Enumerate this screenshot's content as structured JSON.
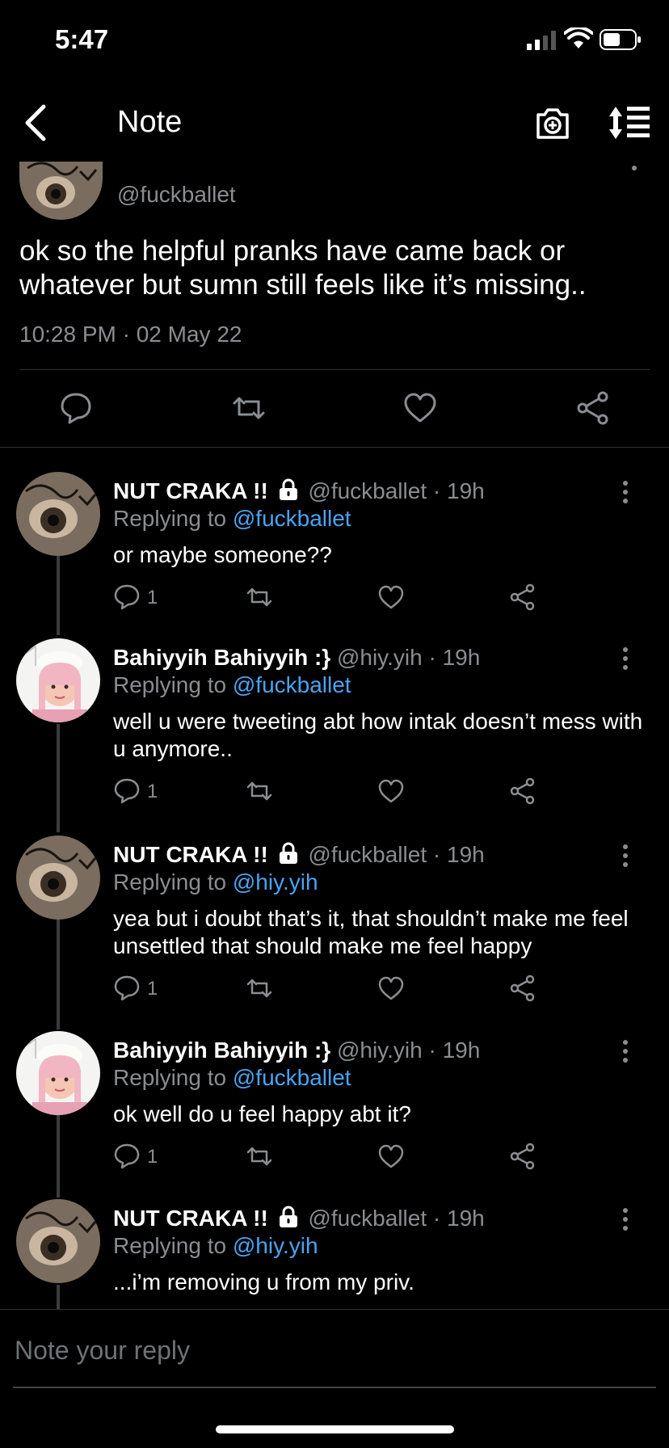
{
  "status_bar": {
    "time": "5:47"
  },
  "nav": {
    "title": "Note"
  },
  "main_post": {
    "handle": "@fuckballet",
    "text": "ok so the helpful pranks have came back or whatever but sumn still feels like it’s missing..",
    "timestamp": "10:28 PM · 02 May 22"
  },
  "replies": [
    {
      "name": "NUT CRAKA !!",
      "locked": true,
      "handle": "@fuckballet",
      "time": "· 19h",
      "replying_prefix": "Replying to ",
      "replying_to": "@fuckballet",
      "text": "or maybe someone??",
      "reply_count": "1",
      "avatar": "cat-avatar"
    },
    {
      "name": "Bahiyyih Bahiyyih :}",
      "locked": false,
      "handle": "@hiy.yih",
      "time": "· 19h",
      "replying_prefix": "Replying to ",
      "replying_to": "@fuckballet",
      "text": "well u were tweeting abt how intak doesn’t mess with u anymore..",
      "reply_count": "1",
      "avatar": "girl-avatar"
    },
    {
      "name": "NUT CRAKA !!",
      "locked": true,
      "handle": "@fuckballet",
      "time": "· 19h",
      "replying_prefix": "Replying to ",
      "replying_to": "@hiy.yih",
      "text": "yea but i doubt that’s it, that shouldn’t make me feel unsettled that should make me feel happy",
      "reply_count": "1",
      "avatar": "cat-avatar"
    },
    {
      "name": "Bahiyyih Bahiyyih :}",
      "locked": false,
      "handle": "@hiy.yih",
      "time": "· 19h",
      "replying_prefix": "Replying to ",
      "replying_to": "@fuckballet",
      "text": "ok well do u feel happy abt it?",
      "reply_count": "1",
      "avatar": "girl-avatar"
    },
    {
      "name": "NUT CRAKA !!",
      "locked": true,
      "handle": "@fuckballet",
      "time": "· 19h",
      "replying_prefix": "Replying to ",
      "replying_to": "@hiy.yih",
      "text": "...i’m removing u from my priv.",
      "reply_count": "",
      "avatar": "cat-avatar"
    }
  ],
  "composer": {
    "placeholder": "Note your reply"
  },
  "colors": {
    "accent": "#4aa3f0",
    "muted": "#8a8d91",
    "background": "#000000",
    "divider": "#2f3336"
  }
}
